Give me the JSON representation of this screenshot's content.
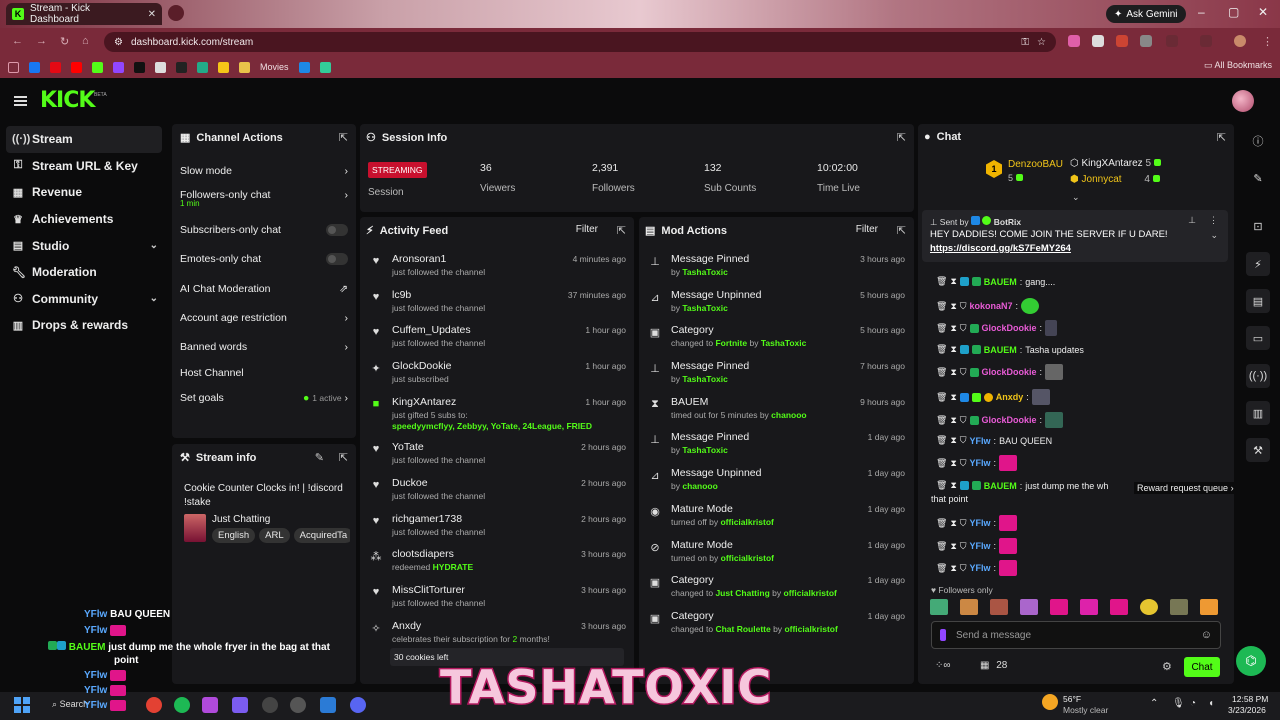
{
  "browser": {
    "tab_title": "Stream - Kick Dashboard",
    "url": "dashboard.kick.com/stream",
    "ask_gemini": "Ask Gemini",
    "bookmarks_folder": "Movies",
    "all_bookmarks": "All Bookmarks"
  },
  "sidebar": {
    "items": [
      {
        "label": "Stream",
        "icon": "stream-icon"
      },
      {
        "label": "Stream URL & Key",
        "icon": "key-icon"
      },
      {
        "label": "Revenue",
        "icon": "revenue-icon"
      },
      {
        "label": "Achievements",
        "icon": "trophy-icon"
      },
      {
        "label": "Studio",
        "icon": "studio-icon"
      },
      {
        "label": "Moderation",
        "icon": "wrench-icon"
      },
      {
        "label": "Community",
        "icon": "community-icon"
      },
      {
        "label": "Drops & rewards",
        "icon": "gift-icon"
      }
    ]
  },
  "channel_actions": {
    "title": "Channel Actions",
    "items": [
      {
        "label": "Slow mode"
      },
      {
        "label": "Followers-only chat",
        "sub": "1 min"
      },
      {
        "label": "Subscribers-only chat"
      },
      {
        "label": "Emotes-only chat"
      },
      {
        "label": "AI Chat Moderation"
      },
      {
        "label": "Account age restriction"
      },
      {
        "label": "Banned words"
      },
      {
        "label": "Host Channel"
      },
      {
        "label": "Set goals",
        "status": "1 active"
      }
    ]
  },
  "stream_info": {
    "title": "Stream info",
    "stream_title": "Cookie Counter Clocks in! | !discord !stake",
    "category": "Just Chatting",
    "tags": [
      "English",
      "ARL",
      "AcquiredTa"
    ]
  },
  "session_info": {
    "title": "Session Info",
    "status": "STREAMING",
    "session_label": "Session",
    "stats": [
      {
        "value": "36",
        "label": "Viewers"
      },
      {
        "value": "2,391",
        "label": "Followers"
      },
      {
        "value": "132",
        "label": "Sub Counts"
      },
      {
        "value": "10:02:00",
        "label": "Time Live"
      }
    ]
  },
  "activity_feed": {
    "title": "Activity Feed",
    "filter": "Filter",
    "items": [
      {
        "name": "Aronsoran1",
        "desc": "just followed the channel",
        "time": "4 minutes ago",
        "icon": "heart-icon"
      },
      {
        "name": "lc9b",
        "desc": "just followed the channel",
        "time": "37 minutes ago",
        "icon": "heart-icon"
      },
      {
        "name": "Cuffem_Updates",
        "desc": "just followed the channel",
        "time": "1 hour ago",
        "icon": "heart-icon"
      },
      {
        "name": "GlockDookie",
        "desc": "just subscribed",
        "time": "1 hour ago",
        "icon": "star-icon"
      },
      {
        "name": "KingXAntarez",
        "desc": "just gifted 5 subs to:",
        "highlight": "speedyymcflyy, Zebbyy, YoTate, 24League, FRIED",
        "time": "1 hour ago",
        "icon": "gift-icon"
      },
      {
        "name": "YoTate",
        "desc": "just followed the channel",
        "time": "2 hours ago",
        "icon": "heart-icon"
      },
      {
        "name": "Duckoe",
        "desc": "just followed the channel",
        "time": "2 hours ago",
        "icon": "heart-icon"
      },
      {
        "name": "richgamer1738",
        "desc": "just followed the channel",
        "time": "2 hours ago",
        "icon": "heart-icon"
      },
      {
        "name": "clootsdiapers",
        "desc": "redeemed",
        "highlight": "HYDRATE",
        "time": "3 hours ago",
        "icon": "reward-icon"
      },
      {
        "name": "MissClitTorturer",
        "desc": "just followed the channel",
        "time": "3 hours ago",
        "icon": "heart-icon"
      },
      {
        "name": "Anxdy",
        "desc": "celebrates their subscription for",
        "highlight": "2",
        "desc2": "months!",
        "time": "3 hours ago",
        "icon": "celebrate-icon",
        "message": "30 cookies left"
      }
    ]
  },
  "mod_actions": {
    "title": "Mod Actions",
    "filter": "Filter",
    "items": [
      {
        "action": "Message Pinned",
        "prefix": "by",
        "who": "TashaToxic",
        "time": "3 hours ago",
        "icon": "pin-icon"
      },
      {
        "action": "Message Unpinned",
        "prefix": "by",
        "who": "TashaToxic",
        "time": "5 hours ago",
        "icon": "unpin-icon"
      },
      {
        "action": "Category",
        "prefix": "changed to",
        "what": "Fortnite",
        "mid": "by",
        "who": "TashaToxic",
        "time": "5 hours ago",
        "icon": "category-icon"
      },
      {
        "action": "Message Pinned",
        "prefix": "by",
        "who": "TashaToxic",
        "time": "7 hours ago",
        "icon": "pin-icon"
      },
      {
        "action": "BAUEM",
        "prefix": "timed out for 5 minutes by",
        "who": "chanooo",
        "time": "9 hours ago",
        "icon": "hourglass-icon"
      },
      {
        "action": "Message Pinned",
        "prefix": "by",
        "who": "TashaToxic",
        "time": "1 day ago",
        "icon": "pin-icon"
      },
      {
        "action": "Message Unpinned",
        "prefix": "by",
        "who": "chanooo",
        "time": "1 day ago",
        "icon": "unpin-icon"
      },
      {
        "action": "Mature Mode",
        "prefix": "turned off by",
        "who": "officialkristof",
        "time": "1 day ago",
        "icon": "eye-icon"
      },
      {
        "action": "Mature Mode",
        "prefix": "turned on by",
        "who": "officialkristof",
        "time": "1 day ago",
        "icon": "eye-off-icon"
      },
      {
        "action": "Category",
        "prefix": "changed to",
        "what": "Just Chatting",
        "mid": "by",
        "who": "officialkristof",
        "time": "1 day ago",
        "icon": "category-icon"
      },
      {
        "action": "Category",
        "prefix": "changed to",
        "what": "Chat Roulette",
        "mid": "by",
        "who": "officialkristof",
        "time": "1 day ago",
        "icon": "category-icon"
      }
    ]
  },
  "chat": {
    "title": "Chat",
    "leaderboard": [
      {
        "name": "DenzooBAU",
        "value": "5"
      },
      {
        "name": "KingXAntarez",
        "value": "5"
      },
      {
        "name": "Jonnycat",
        "value": "4"
      }
    ],
    "pinned": {
      "sent_by_label": "Sent by",
      "sender": "BotRix",
      "text": "HEY DADDIES! COME JOIN THE SERVER IF U DARE!",
      "link": "https://discord.gg/kS7FeMY264"
    },
    "messages": [
      {
        "user": "BAUEM",
        "text": "gang....",
        "color": "#53fc18"
      },
      {
        "user": "kokonaN7",
        "text": "",
        "color": "#e85bd6"
      },
      {
        "user": "GlockDookie",
        "text": "",
        "color": "#e85bd6"
      },
      {
        "user": "BAUEM",
        "text": "Tasha updates",
        "color": "#53fc18"
      },
      {
        "user": "GlockDookie",
        "text": "",
        "color": "#e85bd6"
      },
      {
        "user": "Anxdy",
        "text": "",
        "color": "#f0c419"
      },
      {
        "user": "GlockDookie",
        "text": "",
        "color": "#e85bd6"
      },
      {
        "user": "YFlw",
        "text": "BAU QUEEN",
        "color": "#5aa9ff"
      },
      {
        "user": "YFlw",
        "text": "",
        "color": "#5aa9ff"
      },
      {
        "user": "BAUEM",
        "text": "just dump me the wh",
        "color": "#53fc18"
      },
      {
        "user": "YFlw",
        "text": "",
        "color": "#5aa9ff"
      },
      {
        "user": "YFlw",
        "text": "",
        "color": "#5aa9ff"
      },
      {
        "user": "YFlw",
        "text": "",
        "color": "#5aa9ff"
      }
    ],
    "wrap_text": "that point",
    "reward_queue": "Reward request queue",
    "followers_only": "Followers only",
    "placeholder": "Send a message",
    "points": "28",
    "send": "Chat"
  },
  "overlay": {
    "lines": [
      {
        "user": "YFlw",
        "text": "BAU QUEEN"
      },
      {
        "user": "YFlw",
        "text": ""
      },
      {
        "user": "BAUEM",
        "text": "just dump me the whole fryer in the bag at that"
      },
      {
        "user": "",
        "text": "point"
      },
      {
        "user": "YFlw",
        "text": ""
      },
      {
        "user": "YFlw",
        "text": ""
      },
      {
        "user": "YFlw",
        "text": ""
      }
    ],
    "brand": "TASHATOXIC"
  },
  "taskbar": {
    "search": "Search",
    "weather_temp": "56°F",
    "weather_desc": "Mostly clear",
    "time": "12:58 PM",
    "date": "3/23/2026"
  },
  "colors": {
    "accent": "#53fc18",
    "panel": "#18181b",
    "streaming": "#c8102e"
  }
}
